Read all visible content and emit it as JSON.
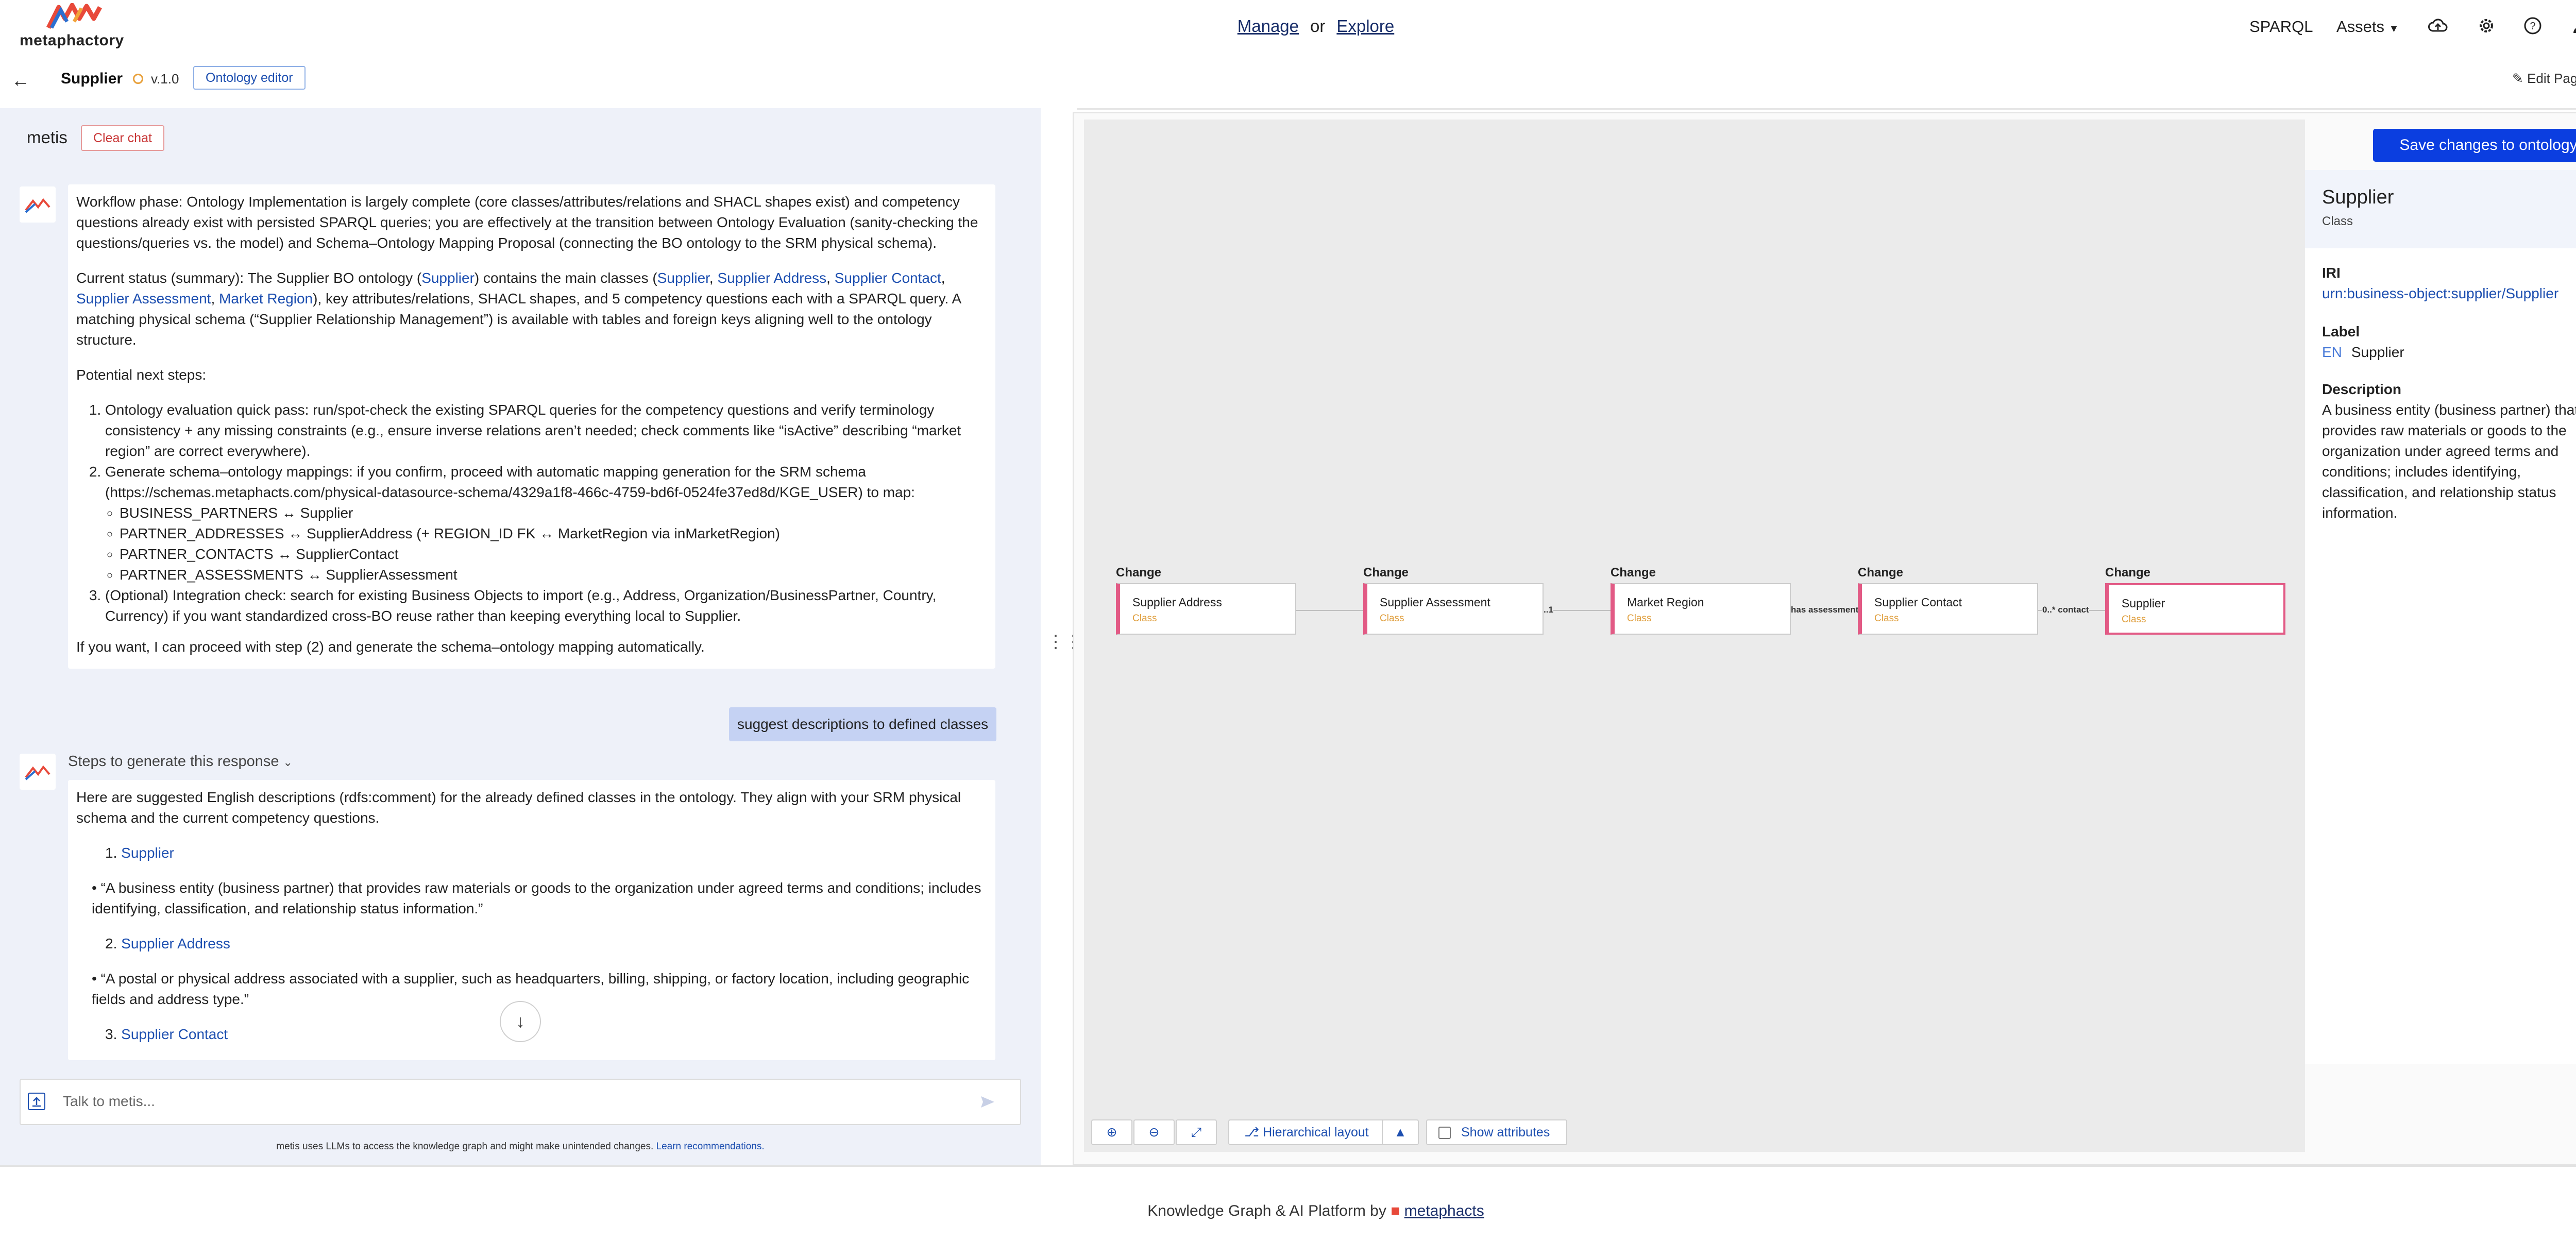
{
  "brand": {
    "name": "metaphactory"
  },
  "nav": {
    "manage": "Manage",
    "or": "or",
    "explore": "Explore",
    "sparql": "SPARQL",
    "assets": "Assets",
    "icons": [
      "cloud-upload-icon",
      "gear-icon",
      "help-icon",
      "user-icon"
    ]
  },
  "page": {
    "title": "Supplier",
    "version": "v.1.0",
    "mode_button": "Ontology editor",
    "edit_page": "Edit Page"
  },
  "chat": {
    "title": "metis",
    "clear": "Clear chat",
    "msg1": {
      "p1": "Workflow phase: Ontology Implementation is largely complete (core classes/attributes/relations and SHACL shapes exist) and competency questions already exist with persisted SPARQL queries; you are effectively at the transition between Ontology Evaluation (sanity-checking the questions/queries vs. the model) and Schema–Ontology Mapping Proposal (connecting the BO ontology to the SRM physical schema).",
      "p2_a": "Current status (summary): The Supplier BO ontology (",
      "p2_link1": "Supplier",
      "p2_b": ") contains the main classes (",
      "p2_link2": "Supplier",
      "p2_link3": "Supplier Address",
      "p2_link4": "Supplier Contact",
      "p2_link5": "Supplier Assessment",
      "p2_link6": "Market Region",
      "p2_c": "), key attributes/relations, SHACL shapes, and 5 competency questions each with a SPARQL query. A matching physical schema (“Supplier Relationship Management”) is available with tables and foreign keys aligning well to the ontology structure.",
      "p3": "Potential next steps:",
      "step1": "Ontology evaluation quick pass: run/spot-check the existing SPARQL queries for the competency questions and verify terminology consistency + any missing constraints (e.g., ensure inverse relations aren’t needed; check comments like “isActive” describing “market region” are correct everywhere).",
      "step2": "Generate schema–ontology mappings: if you confirm, proceed with automatic mapping generation for the SRM schema (https://schemas.metaphacts.com/physical-datasource-schema/4329a1f8-466c-4759-bd6f-0524fe37ed8d/KGE_USER) to map:",
      "mappings": [
        "BUSINESS_PARTNERS ↔ Supplier",
        "PARTNER_ADDRESSES ↔ SupplierAddress (+ REGION_ID FK ↔ MarketRegion via inMarketRegion)",
        "PARTNER_CONTACTS ↔ SupplierContact",
        "PARTNER_ASSESSMENTS ↔ SupplierAssessment"
      ],
      "step3": "(Optional) Integration check: search for existing Business Objects to import (e.g., Address, Organization/BusinessPartner, Country, Currency) if you want standardized cross-BO reuse rather than keeping everything local to Supplier.",
      "p4": "If you want, I can proceed with step (2) and generate the schema–ontology mapping automatically."
    },
    "user_msg": "suggest descriptions to defined classes",
    "steps_toggle": "Steps to generate this response",
    "msg2": {
      "intro": "Here are suggested English descriptions (rdfs:comment) for the already defined classes in the ontology. They align with your SRM physical schema and the current competency questions.",
      "item1": "Supplier",
      "desc1": "“A business entity (business partner) that provides raw materials or goods to the organization under agreed terms and conditions; includes identifying, classification, and relationship status information.”",
      "item2": "Supplier Address",
      "desc2": "“A postal or physical address associated with a supplier, such as headquarters, billing, shipping, or factory location, including geographic fields and address type.”",
      "item3": "Supplier Contact"
    },
    "input_placeholder": "Talk to metis...",
    "disclaimer": "metis uses LLMs to access the knowledge graph and might make unintended changes.",
    "disclaimer_link": "Learn recommendations."
  },
  "editor": {
    "save_button": "Save changes to ontology",
    "nodes": [
      {
        "change": "Change",
        "name": "Supplier Address",
        "type": "Class"
      },
      {
        "change": "Change",
        "name": "Supplier Assessment",
        "type": "Class"
      },
      {
        "change": "Change",
        "name": "Market Region",
        "type": "Class"
      },
      {
        "change": "Change",
        "name": "Supplier Contact",
        "type": "Class"
      },
      {
        "change": "Change",
        "name": "Supplier",
        "type": "Class"
      }
    ],
    "edges": [
      {
        "label": "..1"
      },
      {
        "label": "has assessment"
      },
      {
        "label": "0..* contact"
      }
    ],
    "toolbar": {
      "layout": "Hierarchical layout",
      "show_attributes": "Show attributes"
    },
    "details": {
      "title": "Supplier",
      "type": "Class",
      "iri_label": "IRI",
      "iri": "urn:business-object:supplier/Supplier",
      "label_label": "Label",
      "lang": "EN",
      "label_value": "Supplier",
      "desc_label": "Description",
      "description": "A business entity (business partner) that provides raw materials or goods to the organization under agreed terms and conditions; includes identifying, classification, and relationship status information."
    }
  },
  "footer": {
    "text": "Knowledge Graph & AI Platform by",
    "link": "metaphacts"
  },
  "colors": {
    "accent": "#0b3ee0",
    "chat_bg": "#eef1f9",
    "user_bubble": "#c5d2f3",
    "node_border": "#e25a85",
    "node_type": "#e0a040"
  }
}
